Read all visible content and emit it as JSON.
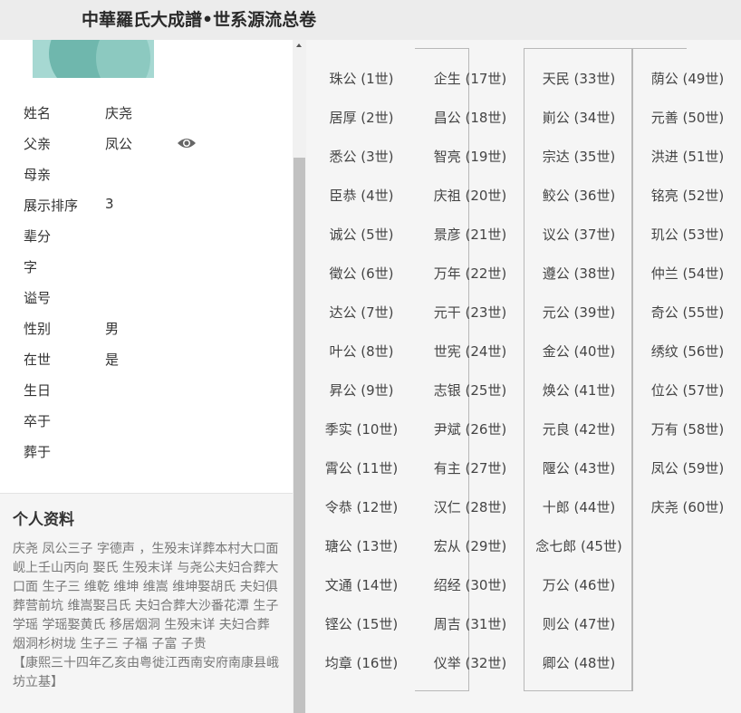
{
  "header": {
    "title": "中華羅氏大成譜•世系源流总卷"
  },
  "fields": [
    {
      "label": "姓名",
      "value": "庆尧"
    },
    {
      "label": "父亲",
      "value": "凤公"
    },
    {
      "label": "母亲",
      "value": ""
    },
    {
      "label": "展示排序",
      "value": "3"
    },
    {
      "label": "辈分",
      "value": ""
    },
    {
      "label": "字",
      "value": ""
    },
    {
      "label": "谥号",
      "value": ""
    },
    {
      "label": "性别",
      "value": "男"
    },
    {
      "label": "在世",
      "value": "是"
    },
    {
      "label": "生日",
      "value": ""
    },
    {
      "label": "卒于",
      "value": ""
    },
    {
      "label": "葬于",
      "value": ""
    }
  ],
  "icons": {
    "father_view": "eye-icon"
  },
  "profile": {
    "title": "个人资料",
    "text": "庆尧 凤公三子 字德声 ，生殁末详葬本村大口面岘上壬山丙向 娶氏 生殁末详 与尧公夫妇合葬大口面 生子三 维乾 维坤 维嵩 维坤娶胡氏 夫妇俱葬营前坑 维嵩娶吕氏 夫妇合葬大沙番花潭 生子 学瑶 学瑶娶黄氏 移居烟洞 生殁末详 夫妇合葬 烟洞杉树垅 生子三 子福 子富 子贵",
    "note": "【康熙三十四年乙亥由粤徙江西南安府南康县峨坊立基】"
  },
  "generations": [
    [
      "珠公 (1世)",
      "居厚 (2世)",
      "悉公 (3世)",
      "臣恭 (4世)",
      "诚公 (5世)",
      "徵公 (6世)",
      "达公 (7世)",
      "叶公 (8世)",
      "昇公 (9世)",
      "季实 (10世)",
      "霄公 (11世)",
      "令恭 (12世)",
      "瑭公 (13世)",
      "文通 (14世)",
      "铿公 (15世)",
      "均章 (16世)"
    ],
    [
      "企生 (17世)",
      "昌公 (18世)",
      "智亮 (19世)",
      "庆祖 (20世)",
      "景彦 (21世)",
      "万年 (22世)",
      "元干 (23世)",
      "世宪 (24世)",
      "志银 (25世)",
      "尹斌 (26世)",
      "有主 (27世)",
      "汉仁 (28世)",
      "宏从 (29世)",
      "绍经 (30世)",
      "周吉 (31世)",
      "仪举 (32世)"
    ],
    [
      "天民 (33世)",
      "崱公 (34世)",
      "宗达 (35世)",
      "鲛公 (36世)",
      "议公 (37世)",
      "遵公 (38世)",
      "元公 (39世)",
      "金公 (40世)",
      "焕公 (41世)",
      "元良 (42世)",
      "隁公 (43世)",
      "十郎 (44世)",
      "念七郎 (45世)",
      "万公 (46世)",
      "则公 (47世)",
      "卿公 (48世)"
    ],
    [
      "荫公 (49世)",
      "元善 (50世)",
      "洪进 (51世)",
      "铭亮 (52世)",
      "玑公 (53世)",
      "仲兰 (54世)",
      "奇公 (55世)",
      "绣纹 (56世)",
      "位公 (57世)",
      "万有 (58世)",
      "凤公 (59世)",
      "庆尧 (60世)"
    ]
  ]
}
